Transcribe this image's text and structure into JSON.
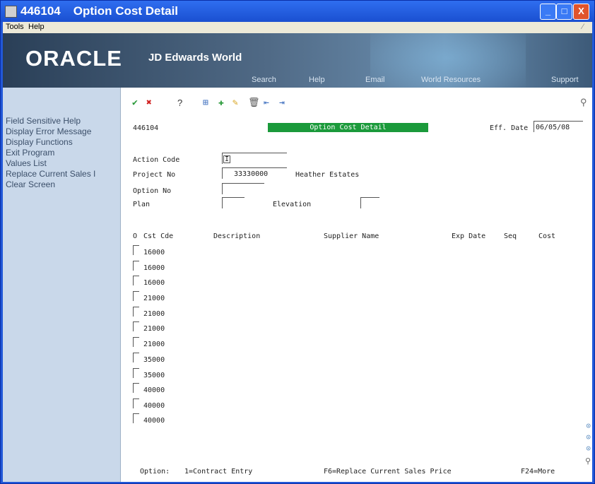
{
  "window": {
    "program_id": "446104",
    "title": "Option Cost Detail",
    "controls": {
      "minimize": "_",
      "maximize": "□",
      "close": "X"
    }
  },
  "menu": {
    "tools": "Tools",
    "help": "Help"
  },
  "banner": {
    "logo": "ORACLE",
    "product": "JD Edwards World",
    "nav": {
      "search": "Search",
      "help": "Help",
      "email": "Email",
      "world_resources": "World Resources",
      "support": "Support"
    }
  },
  "sidebar": {
    "items": [
      {
        "label": "Field Sensitive Help"
      },
      {
        "label": "Display Error Message"
      },
      {
        "label": "Display Functions"
      },
      {
        "label": "Exit Program"
      },
      {
        "label": "Values List"
      },
      {
        "label": "Replace Current Sales I"
      },
      {
        "label": "Clear Screen"
      }
    ]
  },
  "toolbar": {
    "help_glyph": "?"
  },
  "form": {
    "program_id": "446104",
    "header": "Option Cost Detail",
    "eff_date_label": "Eff. Date",
    "eff_date_value": "06/05/08",
    "action_code_label": "Action Code",
    "action_code_value": "I",
    "project_no_label": "Project No",
    "project_no_value": "33330000",
    "project_name": "Heather Estates",
    "option_no_label": "Option No",
    "plan_label": "Plan",
    "elevation_label": "Elevation"
  },
  "grid": {
    "columns": {
      "o": "O",
      "cst_cde": "Cst Cde",
      "description": "Description",
      "supplier": "Supplier Name",
      "exp_date": "Exp Date",
      "seq": "Seq",
      "cost": "Cost"
    },
    "rows": [
      {
        "cst_cde": "16000"
      },
      {
        "cst_cde": "16000"
      },
      {
        "cst_cde": "16000"
      },
      {
        "cst_cde": "21000"
      },
      {
        "cst_cde": "21000"
      },
      {
        "cst_cde": "21000"
      },
      {
        "cst_cde": "21000"
      },
      {
        "cst_cde": "35000"
      },
      {
        "cst_cde": "35000"
      },
      {
        "cst_cde": "40000"
      },
      {
        "cst_cde": "40000"
      },
      {
        "cst_cde": "40000"
      }
    ]
  },
  "footer": {
    "option_label": "Option:",
    "option_1": "1=Contract Entry",
    "f6": "F6=Replace Current Sales Price",
    "f24": "F24=More"
  }
}
